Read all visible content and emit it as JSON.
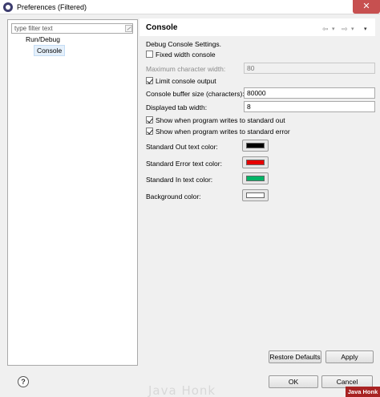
{
  "window": {
    "title": "Preferences (Filtered)",
    "close_glyph": "✕",
    "app_icon": "eclipse-icon"
  },
  "sidebar": {
    "filter_placeholder": "type filter text",
    "tree": {
      "parent_label": "Run/Debug",
      "child_label": "Console"
    }
  },
  "page": {
    "title": "Console",
    "nav": {
      "back_glyph": "⇦",
      "forward_glyph": "⇨",
      "dropdown_glyph": "▾"
    },
    "description": "Debug Console Settings.",
    "fixed_width": {
      "label": "Fixed width console",
      "checked": false
    },
    "max_char_width": {
      "label": "Maximum character width:",
      "value": "80",
      "enabled": false
    },
    "limit_output": {
      "label": "Limit console output",
      "checked": true
    },
    "buffer_size": {
      "label": "Console buffer size (characters):",
      "value": "80000"
    },
    "tab_width": {
      "label": "Displayed tab width:",
      "value": "8"
    },
    "show_on_stdout": {
      "label": "Show when program writes to standard out",
      "checked": true
    },
    "show_on_stderr": {
      "label": "Show when program writes to standard error",
      "checked": true
    },
    "colors": [
      {
        "label": "Standard Out text color:",
        "hex": "#000000"
      },
      {
        "label": "Standard Error text color:",
        "hex": "#e60000"
      },
      {
        "label": "Standard In text color:",
        "hex": "#00b466"
      },
      {
        "label": "Background color:",
        "hex": "#ffffff"
      }
    ],
    "restore_defaults_label": "Restore Defaults",
    "apply_label": "Apply"
  },
  "footer": {
    "help_glyph": "?",
    "ok_label": "OK",
    "cancel_label": "Cancel"
  },
  "watermark": {
    "text": "Java Honk",
    "badge": "Java Honk"
  }
}
